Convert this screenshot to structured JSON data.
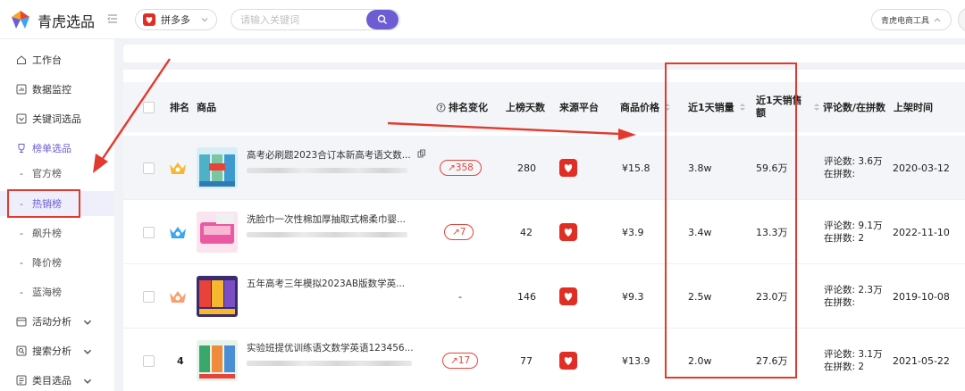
{
  "header": {
    "app_name": "青虎选品",
    "platform_label": "拼多多",
    "search_placeholder": "请输入关键词",
    "tool_label": "青虎电商工具"
  },
  "sidebar": {
    "items": [
      {
        "label": "工作台",
        "icon": "home-icon"
      },
      {
        "label": "数据监控",
        "icon": "chart-icon"
      },
      {
        "label": "关键词选品",
        "icon": "keyword-icon"
      },
      {
        "label": "榜单选品",
        "icon": "trophy-icon",
        "active": true
      }
    ],
    "sub_items": [
      {
        "label": "官方榜"
      },
      {
        "label": "热销榜",
        "selected": true
      },
      {
        "label": "飙升榜"
      },
      {
        "label": "降价榜"
      },
      {
        "label": "蓝海榜"
      }
    ],
    "bottom_items": [
      {
        "label": "活动分析",
        "icon": "calendar-icon"
      },
      {
        "label": "搜索分析",
        "icon": "search-analysis-icon"
      },
      {
        "label": "类目选品",
        "icon": "category-icon"
      }
    ]
  },
  "table": {
    "columns": {
      "rank": "排名",
      "product": "商品",
      "rank_change": "排名变化",
      "days_on_list": "上榜天数",
      "source": "来源平台",
      "price": "商品价格",
      "sales_1d": "近1天销量",
      "revenue_1d_line1": "近1天销售",
      "revenue_1d_line2": "额",
      "comments": "评论数/在拼数",
      "listed": "上架时间"
    },
    "rows": [
      {
        "rank": "",
        "crown": "gold",
        "name": "高考必刷题2023合订本新高考语文数...",
        "change": "↗358",
        "days": "280",
        "price": "¥15.8",
        "sales": "3.8w",
        "revenue": "59.6万",
        "comments": "评论数: 3.6万",
        "pinning": "在拼数:",
        "listed": "2020-03-12"
      },
      {
        "rank": "",
        "crown": "blue",
        "name": "洗脸巾一次性棉加厚抽取式棉柔巾婴...",
        "change": "↗7",
        "days": "42",
        "price": "¥3.9",
        "sales": "3.4w",
        "revenue": "13.3万",
        "comments": "评论数: 9.1万",
        "pinning": "在拼数: 2",
        "listed": "2022-11-10"
      },
      {
        "rank": "",
        "crown": "orange",
        "name": "五年高考三年模拟2023AB版数学英...",
        "change": "-",
        "days": "146",
        "price": "¥9.3",
        "sales": "2.5w",
        "revenue": "23.0万",
        "comments": "评论数: 2.3万",
        "pinning": "在拼数:",
        "listed": "2019-10-08"
      },
      {
        "rank": "4",
        "crown": "",
        "name": "实验班提优训练语文数学英语123456...",
        "change": "↗17",
        "days": "77",
        "price": "¥13.9",
        "sales": "2.0w",
        "revenue": "27.6万",
        "comments": "评论数: 3.1万",
        "pinning": "在拼数: 2",
        "listed": "2021-05-22"
      }
    ]
  },
  "colors": {
    "accent": "#6c5dd3",
    "annotation_red": "#e23a2e",
    "pdd_red": "#e02e24",
    "gold_crown": "#f5b82e",
    "blue_crown": "#3ba6f0",
    "orange_crown": "#f7a070"
  }
}
